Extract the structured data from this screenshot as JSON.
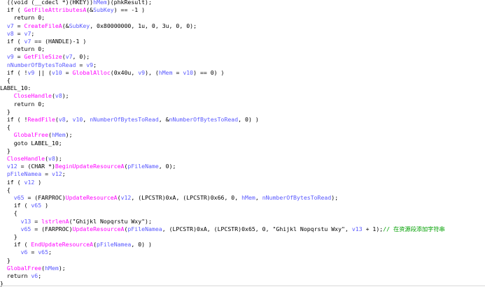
{
  "code": {
    "lines": [
      [
        {
          "t": "  ((void (__cdecl *)(HKEY))",
          "c": ""
        },
        {
          "t": "hMem",
          "c": "var"
        },
        {
          "t": ")(phkResult);",
          "c": ""
        }
      ],
      [
        {
          "t": "  if ( ",
          "c": ""
        },
        {
          "t": "GetFileAttributesA",
          "c": "fn"
        },
        {
          "t": "(&",
          "c": ""
        },
        {
          "t": "SubKey",
          "c": "var"
        },
        {
          "t": ") == -1 )",
          "c": ""
        }
      ],
      [
        {
          "t": "    return 0;",
          "c": ""
        }
      ],
      [
        {
          "t": "  ",
          "c": ""
        },
        {
          "t": "v7",
          "c": "var"
        },
        {
          "t": " = ",
          "c": ""
        },
        {
          "t": "CreateFileA",
          "c": "fn"
        },
        {
          "t": "(&",
          "c": ""
        },
        {
          "t": "SubKey",
          "c": "var"
        },
        {
          "t": ", 0x80000000, 1u, 0, 3u, 0, 0);",
          "c": ""
        }
      ],
      [
        {
          "t": "  ",
          "c": ""
        },
        {
          "t": "v8",
          "c": "var"
        },
        {
          "t": " = ",
          "c": ""
        },
        {
          "t": "v7",
          "c": "var"
        },
        {
          "t": ";",
          "c": ""
        }
      ],
      [
        {
          "t": "  if ( ",
          "c": ""
        },
        {
          "t": "v7",
          "c": "var"
        },
        {
          "t": " == (HANDLE)-1 )",
          "c": ""
        }
      ],
      [
        {
          "t": "    return 0;",
          "c": ""
        }
      ],
      [
        {
          "t": "  ",
          "c": ""
        },
        {
          "t": "v9",
          "c": "var"
        },
        {
          "t": " = ",
          "c": ""
        },
        {
          "t": "GetFileSize",
          "c": "fn"
        },
        {
          "t": "(",
          "c": ""
        },
        {
          "t": "v7",
          "c": "var"
        },
        {
          "t": ", 0);",
          "c": ""
        }
      ],
      [
        {
          "t": "  ",
          "c": ""
        },
        {
          "t": "nNumberOfBytesToRead",
          "c": "var"
        },
        {
          "t": " = ",
          "c": ""
        },
        {
          "t": "v9",
          "c": "var"
        },
        {
          "t": ";",
          "c": ""
        }
      ],
      [
        {
          "t": "  if ( !",
          "c": ""
        },
        {
          "t": "v9",
          "c": "var"
        },
        {
          "t": " || (",
          "c": ""
        },
        {
          "t": "v10",
          "c": "var"
        },
        {
          "t": " = ",
          "c": ""
        },
        {
          "t": "GlobalAlloc",
          "c": "fn"
        },
        {
          "t": "(0x40u, ",
          "c": ""
        },
        {
          "t": "v9",
          "c": "var"
        },
        {
          "t": "), (",
          "c": ""
        },
        {
          "t": "hMem",
          "c": "var"
        },
        {
          "t": " = ",
          "c": ""
        },
        {
          "t": "v10",
          "c": "var"
        },
        {
          "t": ") == 0) )",
          "c": ""
        }
      ],
      [
        {
          "t": "  {",
          "c": ""
        }
      ],
      [
        {
          "t": "LABEL_10:",
          "c": "lbl"
        }
      ],
      [
        {
          "t": "    ",
          "c": ""
        },
        {
          "t": "CloseHandle",
          "c": "fn"
        },
        {
          "t": "(",
          "c": ""
        },
        {
          "t": "v8",
          "c": "var"
        },
        {
          "t": ");",
          "c": ""
        }
      ],
      [
        {
          "t": "    return 0;",
          "c": ""
        }
      ],
      [
        {
          "t": "  }",
          "c": ""
        }
      ],
      [
        {
          "t": "  if ( !",
          "c": ""
        },
        {
          "t": "ReadFile",
          "c": "fn"
        },
        {
          "t": "(",
          "c": ""
        },
        {
          "t": "v8",
          "c": "var"
        },
        {
          "t": ", ",
          "c": ""
        },
        {
          "t": "v10",
          "c": "var"
        },
        {
          "t": ", ",
          "c": ""
        },
        {
          "t": "nNumberOfBytesToRead",
          "c": "var"
        },
        {
          "t": ", &",
          "c": ""
        },
        {
          "t": "nNumberOfBytesToRead",
          "c": "var"
        },
        {
          "t": ", 0) )",
          "c": ""
        }
      ],
      [
        {
          "t": "  {",
          "c": ""
        }
      ],
      [
        {
          "t": "    ",
          "c": ""
        },
        {
          "t": "GlobalFree",
          "c": "fn"
        },
        {
          "t": "(",
          "c": ""
        },
        {
          "t": "hMem",
          "c": "var"
        },
        {
          "t": ");",
          "c": ""
        }
      ],
      [
        {
          "t": "    goto LABEL_10;",
          "c": ""
        }
      ],
      [
        {
          "t": "  }",
          "c": ""
        }
      ],
      [
        {
          "t": "  ",
          "c": ""
        },
        {
          "t": "CloseHandle",
          "c": "fn"
        },
        {
          "t": "(",
          "c": ""
        },
        {
          "t": "v8",
          "c": "var"
        },
        {
          "t": ");",
          "c": ""
        }
      ],
      [
        {
          "t": "  ",
          "c": ""
        },
        {
          "t": "v12",
          "c": "var"
        },
        {
          "t": " = (CHAR *)",
          "c": ""
        },
        {
          "t": "BeginUpdateResourceA",
          "c": "fn"
        },
        {
          "t": "(",
          "c": ""
        },
        {
          "t": "pFileName",
          "c": "var"
        },
        {
          "t": ", 0);",
          "c": ""
        }
      ],
      [
        {
          "t": "  ",
          "c": ""
        },
        {
          "t": "pFileNamea",
          "c": "var"
        },
        {
          "t": " = ",
          "c": ""
        },
        {
          "t": "v12",
          "c": "var"
        },
        {
          "t": ";",
          "c": ""
        }
      ],
      [
        {
          "t": "  if ( ",
          "c": ""
        },
        {
          "t": "v12",
          "c": "var"
        },
        {
          "t": " )",
          "c": ""
        }
      ],
      [
        {
          "t": "  {",
          "c": ""
        }
      ],
      [
        {
          "t": "    ",
          "c": ""
        },
        {
          "t": "v65",
          "c": "var"
        },
        {
          "t": " = (FARPROC)",
          "c": ""
        },
        {
          "t": "UpdateResourceA",
          "c": "fn"
        },
        {
          "t": "(",
          "c": ""
        },
        {
          "t": "v12",
          "c": "var"
        },
        {
          "t": ", (LPCSTR)0xA, (LPCSTR)0x66, 0, ",
          "c": ""
        },
        {
          "t": "hMem",
          "c": "var"
        },
        {
          "t": ", ",
          "c": ""
        },
        {
          "t": "nNumberOfBytesToRead",
          "c": "var"
        },
        {
          "t": ");",
          "c": ""
        }
      ],
      [
        {
          "t": "    if ( ",
          "c": ""
        },
        {
          "t": "v65",
          "c": "var"
        },
        {
          "t": " )",
          "c": ""
        }
      ],
      [
        {
          "t": "    {",
          "c": ""
        }
      ],
      [
        {
          "t": "      ",
          "c": ""
        },
        {
          "t": "v13",
          "c": "var"
        },
        {
          "t": " = ",
          "c": ""
        },
        {
          "t": "lstrlenA",
          "c": "fn"
        },
        {
          "t": "(\"Ghijkl Nopqrstu Wxy\");",
          "c": ""
        }
      ],
      [
        {
          "t": "      ",
          "c": ""
        },
        {
          "t": "v65",
          "c": "var"
        },
        {
          "t": " = (FARPROC)",
          "c": ""
        },
        {
          "t": "UpdateResourceA",
          "c": "fn"
        },
        {
          "t": "(",
          "c": ""
        },
        {
          "t": "pFileNamea",
          "c": "var"
        },
        {
          "t": ", (LPCSTR)0xA, (LPCSTR)0x65, 0, \"Ghijkl Nopqrstu Wxy\", ",
          "c": ""
        },
        {
          "t": "v13",
          "c": "var"
        },
        {
          "t": " + 1);",
          "c": ""
        },
        {
          "t": "// 在资源段添加字符串",
          "c": "cm"
        }
      ],
      [
        {
          "t": "    }",
          "c": ""
        }
      ],
      [
        {
          "t": "    if ( ",
          "c": ""
        },
        {
          "t": "EndUpdateResourceA",
          "c": "fn"
        },
        {
          "t": "(",
          "c": ""
        },
        {
          "t": "pFileNamea",
          "c": "var"
        },
        {
          "t": ", 0) )",
          "c": ""
        }
      ],
      [
        {
          "t": "      ",
          "c": ""
        },
        {
          "t": "v6",
          "c": "var"
        },
        {
          "t": " = ",
          "c": ""
        },
        {
          "t": "v65",
          "c": "var"
        },
        {
          "t": ";",
          "c": ""
        }
      ],
      [
        {
          "t": "  }",
          "c": ""
        }
      ],
      [
        {
          "t": "  ",
          "c": ""
        },
        {
          "t": "GlobalFree",
          "c": "fn"
        },
        {
          "t": "(",
          "c": ""
        },
        {
          "t": "hMem",
          "c": "var"
        },
        {
          "t": ");",
          "c": ""
        }
      ],
      [
        {
          "t": "  return ",
          "c": ""
        },
        {
          "t": "v6",
          "c": "var"
        },
        {
          "t": ";",
          "c": ""
        }
      ],
      [
        {
          "t": "}",
          "c": ""
        }
      ]
    ]
  },
  "colors": {
    "function": "#ff00ff",
    "variable": "#5a5aff",
    "comment": "#00a000",
    "text": "#000000",
    "background": "#ffffff"
  }
}
